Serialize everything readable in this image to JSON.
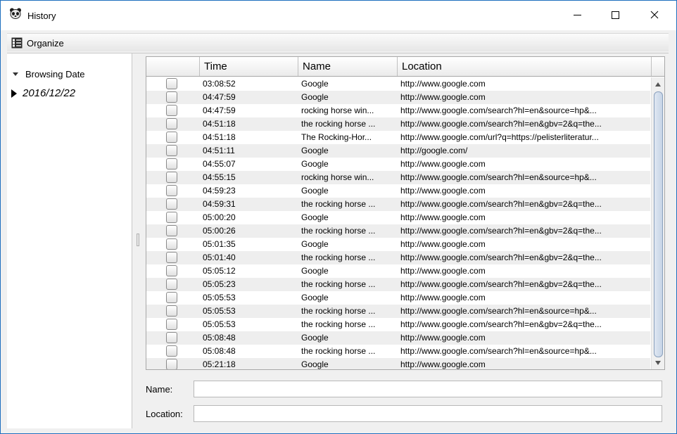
{
  "window": {
    "title": "History"
  },
  "menu": {
    "organize_label": "Organize"
  },
  "tree": {
    "root_label": "Browsing Date",
    "child_label": "2016/12/22"
  },
  "table": {
    "columns": [
      "",
      "Time",
      "Name",
      "Location"
    ],
    "rows": [
      {
        "time": "03:08:52",
        "name": "Google",
        "location": "http://www.google.com"
      },
      {
        "time": "04:47:59",
        "name": "Google",
        "location": "http://www.google.com"
      },
      {
        "time": "04:47:59",
        "name": "rocking horse win...",
        "location": "http://www.google.com/search?hl=en&source=hp&..."
      },
      {
        "time": "04:51:18",
        "name": "the rocking horse ...",
        "location": "http://www.google.com/search?hl=en&gbv=2&q=the..."
      },
      {
        "time": "04:51:18",
        "name": "The Rocking-Hor...",
        "location": "http://www.google.com/url?q=https://pelisterliteratur..."
      },
      {
        "time": "04:51:11",
        "name": "Google",
        "location": "http://google.com/"
      },
      {
        "time": "04:55:07",
        "name": "Google",
        "location": "http://www.google.com"
      },
      {
        "time": "04:55:15",
        "name": "rocking horse win...",
        "location": "http://www.google.com/search?hl=en&source=hp&..."
      },
      {
        "time": "04:59:23",
        "name": "Google",
        "location": "http://www.google.com"
      },
      {
        "time": "04:59:31",
        "name": "the rocking horse ...",
        "location": "http://www.google.com/search?hl=en&gbv=2&q=the..."
      },
      {
        "time": "05:00:20",
        "name": "Google",
        "location": "http://www.google.com"
      },
      {
        "time": "05:00:26",
        "name": "the rocking horse ...",
        "location": "http://www.google.com/search?hl=en&gbv=2&q=the..."
      },
      {
        "time": "05:01:35",
        "name": "Google",
        "location": "http://www.google.com"
      },
      {
        "time": "05:01:40",
        "name": "the rocking horse ...",
        "location": "http://www.google.com/search?hl=en&gbv=2&q=the..."
      },
      {
        "time": "05:05:12",
        "name": "Google",
        "location": "http://www.google.com"
      },
      {
        "time": "05:05:23",
        "name": "the rocking horse ...",
        "location": "http://www.google.com/search?hl=en&gbv=2&q=the..."
      },
      {
        "time": "05:05:53",
        "name": "Google",
        "location": "http://www.google.com"
      },
      {
        "time": "05:05:53",
        "name": "the rocking horse ...",
        "location": "http://www.google.com/search?hl=en&source=hp&..."
      },
      {
        "time": "05:05:53",
        "name": "the rocking horse ...",
        "location": "http://www.google.com/search?hl=en&gbv=2&q=the..."
      },
      {
        "time": "05:08:48",
        "name": "Google",
        "location": "http://www.google.com"
      },
      {
        "time": "05:08:48",
        "name": "the rocking horse ...",
        "location": "http://www.google.com/search?hl=en&source=hp&..."
      },
      {
        "time": "05:21:18",
        "name": "Google",
        "location": "http://www.google.com"
      }
    ]
  },
  "fields": {
    "name_label": "Name:",
    "name_value": "",
    "location_label": "Location:",
    "location_value": ""
  },
  "icons": {
    "app": "panda-icon",
    "organize": "checklist-icon",
    "minimize": "minimize-icon",
    "maximize": "maximize-icon",
    "close": "close-icon"
  }
}
